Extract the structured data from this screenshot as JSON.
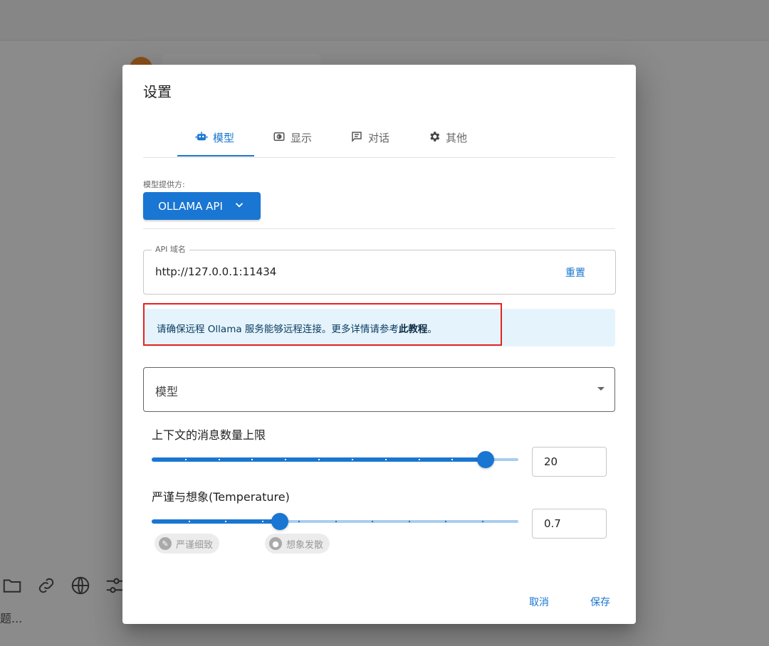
{
  "background": {
    "input_placeholder": "题...",
    "toolbar_icons": [
      "folder-icon",
      "link-icon",
      "globe-icon",
      "sliders-icon"
    ]
  },
  "dialog": {
    "title": "设置",
    "tabs": [
      {
        "label": "模型",
        "icon": "robot-icon",
        "active": true
      },
      {
        "label": "显示",
        "icon": "display-icon",
        "active": false
      },
      {
        "label": "对话",
        "icon": "chat-icon",
        "active": false
      },
      {
        "label": "其他",
        "icon": "gear-icon",
        "active": false
      }
    ],
    "provider": {
      "label": "模型提供方:",
      "value": "OLLAMA API"
    },
    "api_domain": {
      "label": "API 域名",
      "value": "http://127.0.0.1:11434",
      "reset_label": "重置"
    },
    "alert": {
      "text": "请确保远程 Ollama 服务能够远程连接。更多详情请参考",
      "link": "此教程",
      "suffix": "。"
    },
    "model_select": {
      "placeholder": "模型"
    },
    "context_limit": {
      "label": "上下文的消息数量上限",
      "value": "20",
      "slider_fraction": 0.91
    },
    "temperature": {
      "label": "严谨与想象(Temperature)",
      "value": "0.7",
      "slider_fraction": 0.35,
      "chips": [
        "严谨细致",
        "想象发散"
      ]
    },
    "cancel_label": "取消",
    "save_label": "保存"
  },
  "colors": {
    "primary": "#1976d2",
    "alert_bg": "#e5f4fc",
    "highlight": "#e8221f"
  }
}
